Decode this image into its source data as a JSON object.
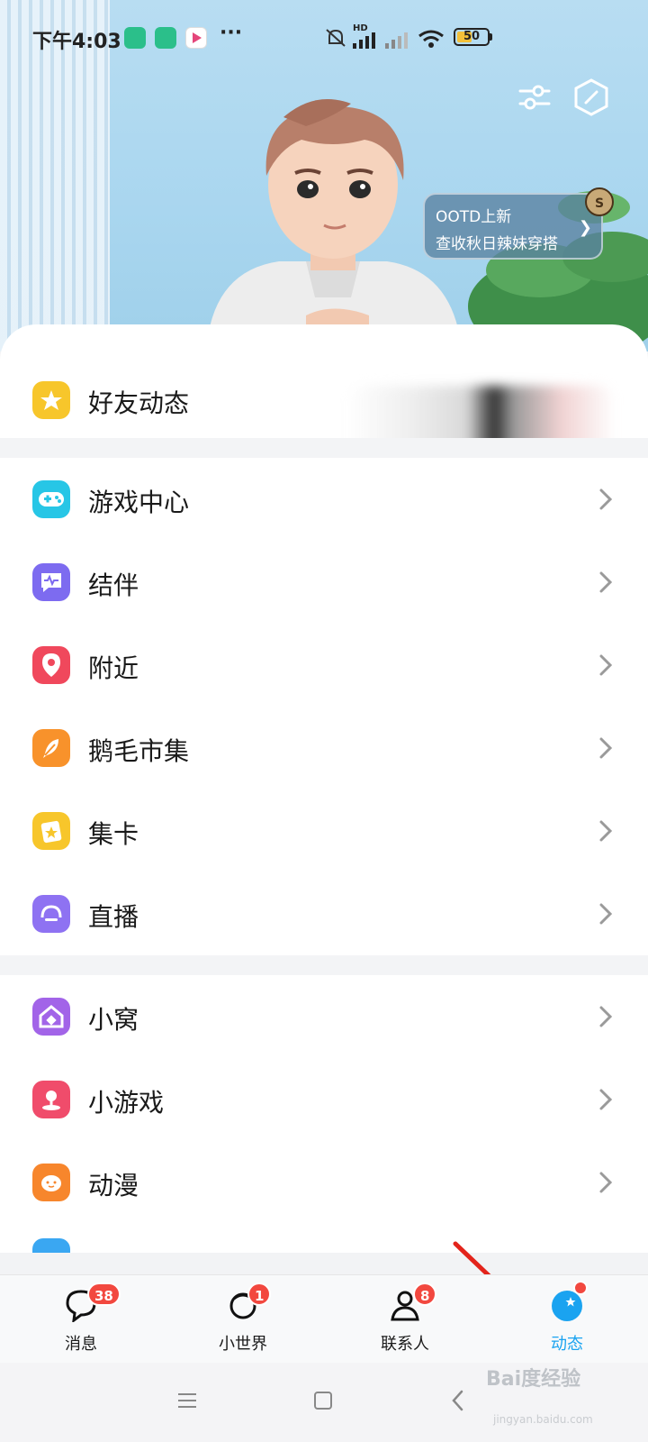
{
  "status_bar": {
    "time": "下午4:03",
    "more": "···",
    "network": "HD",
    "battery": 50
  },
  "promo": {
    "line1": "OOTD上新",
    "line2": "查收秋日辣妹穿搭",
    "tag": "S"
  },
  "colors": {
    "accent": "#1aa3f0",
    "badge": "#f2483f"
  },
  "menu": {
    "friends_feed": {
      "label": "好友动态",
      "icon": "star-icon"
    },
    "group1": [
      {
        "label": "游戏中心",
        "icon": "gamepad-icon"
      },
      {
        "label": "结伴",
        "icon": "chat-wave-icon"
      },
      {
        "label": "附近",
        "icon": "location-pin-icon"
      },
      {
        "label": "鹅毛市集",
        "icon": "feather-icon"
      },
      {
        "label": "集卡",
        "icon": "card-icon"
      },
      {
        "label": "直播",
        "icon": "live-icon"
      }
    ],
    "group2": [
      {
        "label": "小窝",
        "icon": "house-icon"
      },
      {
        "label": "小游戏",
        "icon": "joystick-icon"
      },
      {
        "label": "动漫",
        "icon": "anime-face-icon"
      }
    ]
  },
  "tabs": [
    {
      "label": "消息",
      "badge": "38",
      "icon": "message-icon"
    },
    {
      "label": "小世界",
      "badge": "1",
      "icon": "planet-icon"
    },
    {
      "label": "联系人",
      "badge": "8",
      "icon": "contact-icon"
    },
    {
      "label": "动态",
      "badge": "",
      "icon": "star-circle-icon",
      "active": true
    }
  ],
  "watermark": {
    "main": "Bai度经验",
    "sub": "jingyan.baidu.com"
  }
}
